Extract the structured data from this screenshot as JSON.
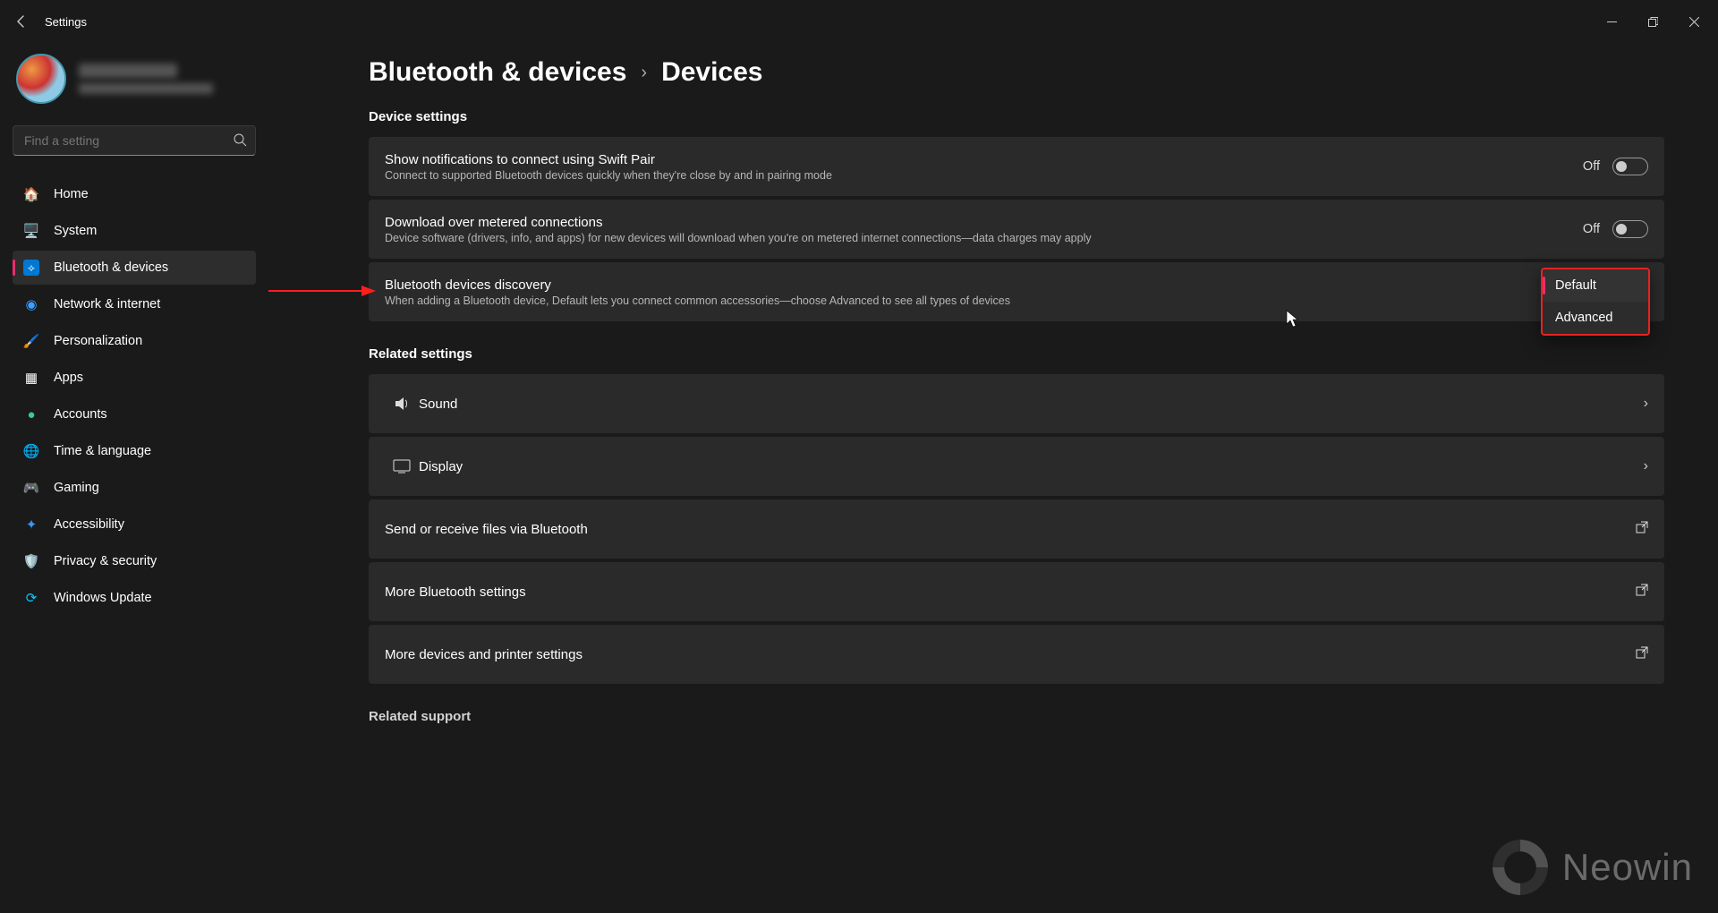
{
  "window": {
    "title": "Settings"
  },
  "search": {
    "placeholder": "Find a setting"
  },
  "nav": {
    "items": [
      {
        "label": "Home"
      },
      {
        "label": "System"
      },
      {
        "label": "Bluetooth & devices"
      },
      {
        "label": "Network & internet"
      },
      {
        "label": "Personalization"
      },
      {
        "label": "Apps"
      },
      {
        "label": "Accounts"
      },
      {
        "label": "Time & language"
      },
      {
        "label": "Gaming"
      },
      {
        "label": "Accessibility"
      },
      {
        "label": "Privacy & security"
      },
      {
        "label": "Windows Update"
      }
    ],
    "active_index": 2
  },
  "breadcrumb": {
    "parent": "Bluetooth & devices",
    "current": "Devices"
  },
  "sections": {
    "device_settings": {
      "title": "Device settings",
      "rows": [
        {
          "title": "Show notifications to connect using Swift Pair",
          "desc": "Connect to supported Bluetooth devices quickly when they're close by and in pairing mode",
          "toggle_state": "Off"
        },
        {
          "title": "Download over metered connections",
          "desc": "Device software (drivers, info, and apps) for new devices will download when you're on metered internet connections—data charges may apply",
          "toggle_state": "Off"
        },
        {
          "title": "Bluetooth devices discovery",
          "desc": "When adding a Bluetooth device, Default lets you connect common accessories—choose Advanced to see all types of devices",
          "dropdown": {
            "options": [
              "Default",
              "Advanced"
            ],
            "selected_index": 0
          }
        }
      ]
    },
    "related": {
      "title": "Related settings",
      "rows": [
        {
          "title": "Sound",
          "action": "navigate"
        },
        {
          "title": "Display",
          "action": "navigate"
        },
        {
          "title": "Send or receive files via Bluetooth",
          "action": "external"
        },
        {
          "title": "More Bluetooth settings",
          "action": "external"
        },
        {
          "title": "More devices and printer settings",
          "action": "external"
        }
      ]
    },
    "support": {
      "title": "Related support"
    }
  },
  "watermark": "Neowin",
  "colors": {
    "accent": "#e62e6b",
    "highlight_box": "#e62222",
    "card_bg": "#2a2a2a",
    "page_bg": "#1a1a1a"
  }
}
